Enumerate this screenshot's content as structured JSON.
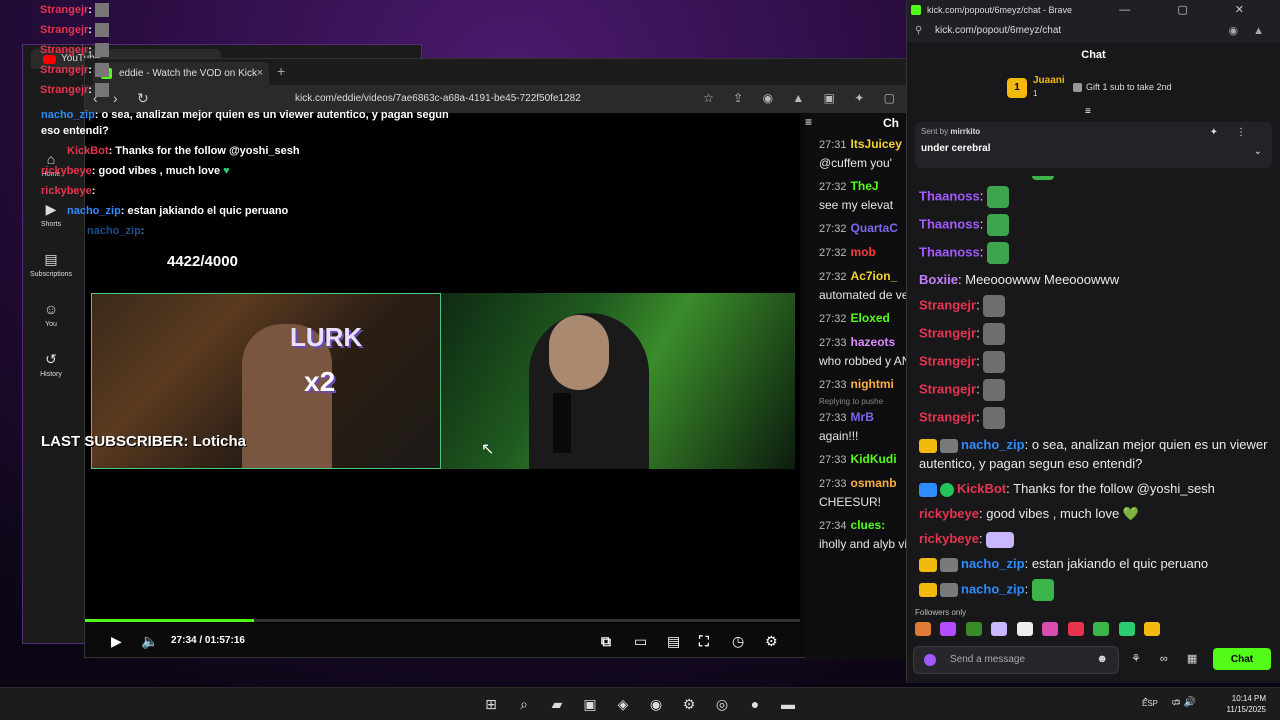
{
  "overlay_chat": {
    "lines": [
      {
        "name": "Strangejr",
        "sep": ":"
      },
      {
        "name": "Strangejr",
        "sep": ":"
      },
      {
        "name": "Strangejr",
        "sep": ":"
      },
      {
        "name": "Strangejr",
        "sep": ":"
      },
      {
        "name": "Strangejr",
        "sep": ":"
      }
    ],
    "messages": [
      {
        "name": "nacho_zip",
        "text": ": o sea, analizan mejor quien es un viewer autentico, y pagan segun",
        "cont": "eso entendi?"
      },
      {
        "name": "KickBot",
        "text": ": Thanks for the follow @yoshi_sesh"
      },
      {
        "name": "rickybeye",
        "text": ": good vibes , much love"
      },
      {
        "name": "rickybeye",
        "text": ":"
      },
      {
        "name": "nacho_zip",
        "text": ": estan jakiando el quic peruano"
      },
      {
        "name": "nacho_zip",
        "text": ":"
      }
    ],
    "goal": "4422/4000",
    "last_subscriber": "LAST SUBSCRIBER: Loticha"
  },
  "youtube_window": {
    "tab_label": "YouTube",
    "sidebar": [
      {
        "label": "Home",
        "icon": "home-icon",
        "glyph": "⌂"
      },
      {
        "label": "Shorts",
        "icon": "shorts-icon",
        "glyph": "▶"
      },
      {
        "label": "Subscriptions",
        "icon": "subscriptions-icon",
        "glyph": "▤"
      },
      {
        "label": "You",
        "icon": "user-icon",
        "glyph": "☺"
      },
      {
        "label": "History",
        "icon": "history-icon",
        "glyph": "↺"
      }
    ]
  },
  "kick_window": {
    "tab_title": "eddie - Watch the VOD on Kick",
    "tab_close": "×",
    "new_tab": "+",
    "nav_back": "‹",
    "nav_forward": "›",
    "nav_reload": "↻",
    "url": "kick.com/eddie/videos/7ae6863c-a68a-4191-be45-722f50fe1282",
    "toolbar_icons": "☆ ⇪ ◉ ▲ ▣ ✦ ▢",
    "video": {
      "lurk_text": "LURK",
      "lurk_multiplier": "x2",
      "cursor": "↖",
      "progress_fraction": 0.237,
      "time": "27:34 / 01:57:16"
    },
    "controls": {
      "play": "▶",
      "volume": "🔈",
      "pip": "⧉",
      "theater": "▭",
      "captions": "▤",
      "fullscreen": "⛶",
      "speed": "◷",
      "settings": "⚙"
    },
    "vod_chat": {
      "header_icon": "≡",
      "header_text": "Ch",
      "messages": [
        {
          "time": "27:31",
          "user": "ItsJuicey",
          "color": "#f2d22e",
          "text": "@cuffem you'"
        },
        {
          "time": "27:32",
          "user": "TheJ",
          "color": "#53fc18",
          "text": "see my elevat"
        },
        {
          "time": "27:32",
          "user": "QuartaC",
          "color": "#7b68ee",
          "text": ""
        },
        {
          "time": "27:32",
          "user": "mob",
          "color": "#ff3b3b",
          "text": ""
        },
        {
          "time": "27:32",
          "user": "Ac7ion_",
          "color": "#f2d22e",
          "text": "automated de verification to in real time"
        },
        {
          "time": "27:32",
          "user": "Eloxed",
          "color": "#53fc18",
          "text": ""
        },
        {
          "time": "27:33",
          "user": "hazeots",
          "color": "#d98cff",
          "text": "who robbed y ANDY LOL?"
        },
        {
          "time": "27:33",
          "user": "nightmi",
          "color": "#ffae42",
          "text": ""
        },
        {
          "time": "27:33",
          "user": "MrB",
          "color": "#7b68ee",
          "text": "again!!!",
          "reply": "Replying to pushe"
        },
        {
          "time": "27:33",
          "user": "KidKudi",
          "color": "#53fc18",
          "text": ""
        },
        {
          "time": "27:33",
          "user": "osmanb",
          "color": "#ffae42",
          "text": "CHEESUR!"
        },
        {
          "time": "27:34",
          "user": "clues:",
          "color": "#53fc18",
          "text": "iholly and alyb viewbotters"
        }
      ]
    }
  },
  "chat_window": {
    "title": "kick.com/popout/6meyz/chat - Brave",
    "url": "kick.com/popout/6meyz/chat",
    "window_buttons": "— ▢ ✕",
    "url_icons": "◉ ▲",
    "heading": "Chat",
    "leaderboard": {
      "rank": "1",
      "name": "Juaani",
      "count": "1",
      "gift_text": "Gift 1 sub to take 2nd",
      "menu": "≡"
    },
    "pinned": {
      "sent_by_label": "Sent by",
      "sent_by_name": "mirrkito",
      "message": "under cerebral",
      "pin_icon": "✦",
      "more_icon": "⋮",
      "chevron": "⌄"
    },
    "messages": [
      {
        "user": "nacho_zip",
        "color": "#2d8cff",
        "badges": [
          "crown",
          "sub"
        ],
        "text": "",
        "emote": "green"
      },
      {
        "user": "Thaanoss",
        "color": "#a259ff",
        "badges": [],
        "text": "",
        "emote": "money"
      },
      {
        "user": "Thaanoss",
        "color": "#a259ff",
        "badges": [],
        "text": "",
        "emote": "money"
      },
      {
        "user": "Thaanoss",
        "color": "#a259ff",
        "badges": [],
        "text": "",
        "emote": "money"
      },
      {
        "user": "Boxiie",
        "color": "#c77dff",
        "badges": [],
        "text": "Meeooowww Meeooowww"
      },
      {
        "user": "Strangejr",
        "color": "#e8334e",
        "badges": [],
        "text": "",
        "emote": "grey"
      },
      {
        "user": "Strangejr",
        "color": "#e8334e",
        "badges": [],
        "text": "",
        "emote": "grey"
      },
      {
        "user": "Strangejr",
        "color": "#e8334e",
        "badges": [],
        "text": "",
        "emote": "grey"
      },
      {
        "user": "Strangejr",
        "color": "#e8334e",
        "badges": [],
        "text": "",
        "emote": "grey"
      },
      {
        "user": "Strangejr",
        "color": "#e8334e",
        "badges": [],
        "text": "",
        "emote": "grey"
      },
      {
        "user": "nacho_zip",
        "color": "#2d8cff",
        "badges": [
          "crown",
          "sub"
        ],
        "text": "o sea, analizan mejor quien es un viewer autentico, y pagan segun eso entendi?"
      },
      {
        "user": "KickBot",
        "color": "#e8334e",
        "badges": [
          "bot",
          "verified"
        ],
        "text": "Thanks for the follow @yoshi_sesh"
      },
      {
        "user": "rickybeye",
        "color": "#e8334e",
        "badges": [],
        "text": "good vibes , much love",
        "heart": "💚"
      },
      {
        "user": "rickybeye",
        "color": "#e8334e",
        "badges": [],
        "text": "",
        "emote": "lurk"
      },
      {
        "user": "nacho_zip",
        "color": "#2d8cff",
        "badges": [
          "crown",
          "sub"
        ],
        "text": "estan jakiando el quic peruano"
      },
      {
        "user": "nacho_zip",
        "color": "#2d8cff",
        "badges": [
          "crown",
          "sub"
        ],
        "text": "",
        "emote": "green"
      }
    ],
    "followers_only": "Followers only",
    "input_placeholder": "Send a message",
    "input_emoji": "☻",
    "actions": "⚘ ∞ ▦ ⚙",
    "send_label": "Chat",
    "accent": "#53fc18"
  },
  "taskbar": {
    "apps": [
      {
        "name": "start-icon",
        "glyph": "⊞"
      },
      {
        "name": "search-icon",
        "glyph": "⌕"
      },
      {
        "name": "file-explorer-icon",
        "glyph": "▰"
      },
      {
        "name": "store-icon",
        "glyph": "▣"
      },
      {
        "name": "kick-app-icon",
        "glyph": "◈"
      },
      {
        "name": "discord-icon",
        "glyph": "◉"
      },
      {
        "name": "settings-icon",
        "glyph": "⚙"
      },
      {
        "name": "obs-icon",
        "glyph": "◎"
      },
      {
        "name": "chrome-icon",
        "glyph": "●"
      },
      {
        "name": "app-icon",
        "glyph": "▬"
      }
    ],
    "lang": "ESP",
    "tray": "⌃ ♫",
    "tray_right": "▭ 🔊",
    "time": "10:14 PM",
    "date": "11/15/2025"
  }
}
